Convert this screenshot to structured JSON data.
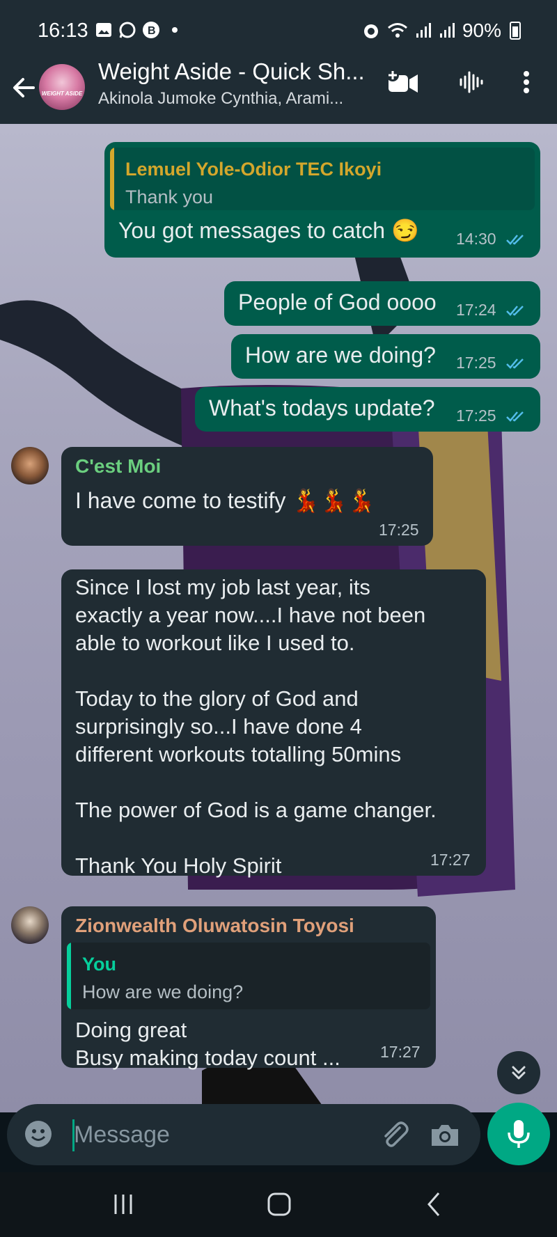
{
  "status_bar": {
    "time": "16:13",
    "battery": "90%",
    "left_icons": [
      "gallery-icon",
      "whatsapp-icon",
      "b-icon",
      "dot-icon"
    ],
    "right_icons": [
      "alarm-icon",
      "wifi-icon",
      "signal-icon",
      "signal-icon"
    ]
  },
  "header": {
    "title": "Weight Aside - Quick Sh...",
    "subtitle": "Akinola Jumoke Cynthia, Arami...",
    "avatar_text": "WEIGHT ASIDE",
    "icons": [
      "back-arrow-icon",
      "add-video-call-icon",
      "voice-call-icon",
      "more-options-icon"
    ]
  },
  "messages": [
    {
      "type": "outgoing",
      "quote_author": "Lemuel Yole-Odior TEC Ikoyi",
      "quote_text": "Thank you",
      "text": "You got messages to catch 😏",
      "time": "14:30"
    },
    {
      "type": "outgoing",
      "text": "People of God oooo",
      "time": "17:24"
    },
    {
      "type": "outgoing",
      "text": "How are we doing?",
      "time": "17:25"
    },
    {
      "type": "outgoing",
      "text": "What's todays update?",
      "time": "17:25"
    },
    {
      "type": "incoming",
      "sender": "C'est Moi",
      "text": "I have come to testify 💃💃💃",
      "time": "17:25"
    },
    {
      "type": "incoming",
      "text": "Since I lost my job last year, its\nexactly a year now....I have not been\nable to workout like I used to.\n\nToday to the glory of God and\nsurprisingly so...I have done 4\ndifferent workouts totalling 50mins\n\nThe power of God is a game changer.\n\nThank You Holy Spirit",
      "time": "17:27"
    },
    {
      "type": "incoming",
      "sender": "Zionwealth Oluwatosin Toyosi",
      "quote_author": "You",
      "quote_text": "How are we doing?",
      "text": "Doing great\nBusy making today count ...",
      "time": "17:27"
    }
  ],
  "input": {
    "placeholder": "Message"
  },
  "colors": {
    "header_bg": "#1f2c34",
    "outgoing_bubble": "#005c4b",
    "incoming_bubble": "#202c33",
    "accent": "#00a884",
    "read_ticks": "#53bdeb",
    "sender_cest_moi": "#6bcf7f",
    "sender_zionwealth": "#e0a07a",
    "quote_lemuel": "#d4a72c",
    "quote_you": "#06cf9c"
  }
}
